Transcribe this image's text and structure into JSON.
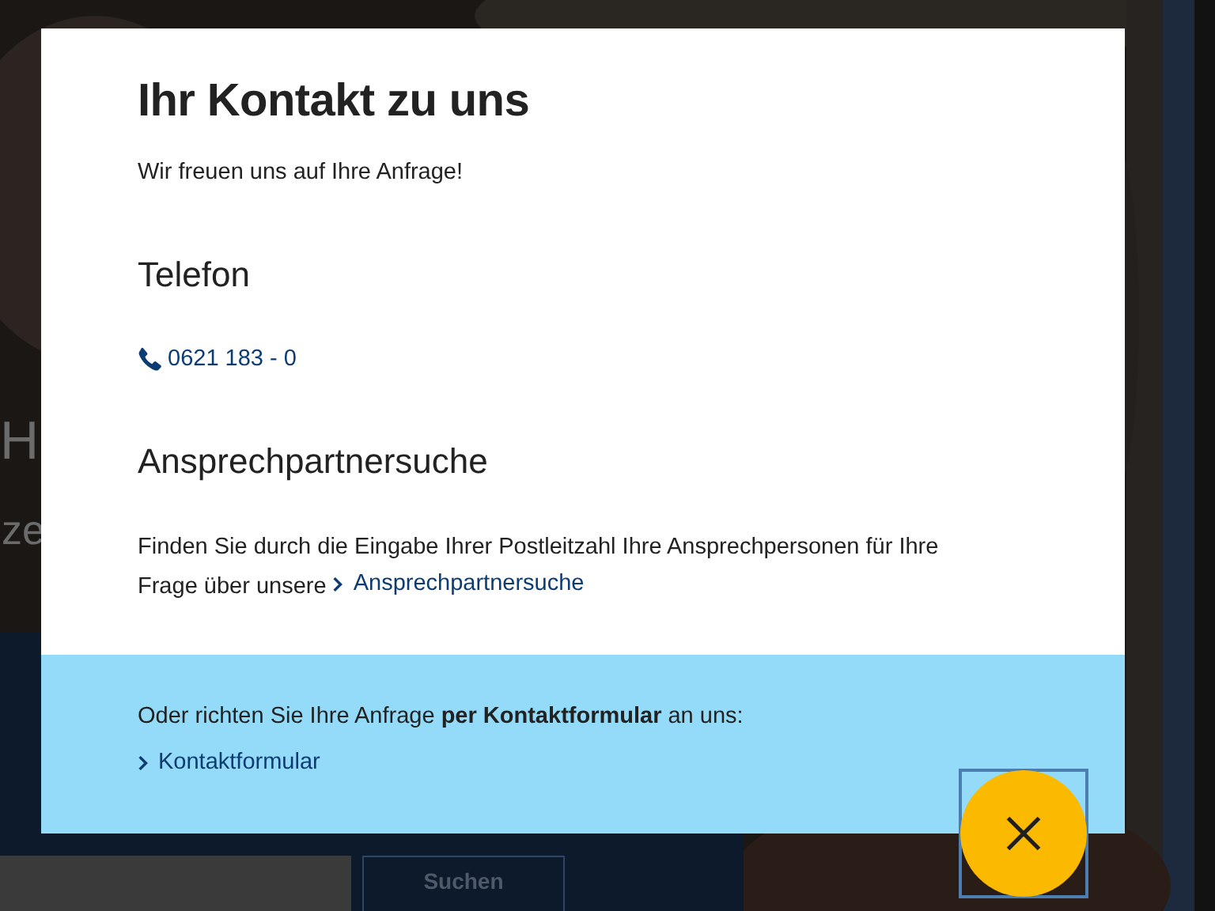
{
  "background": {
    "headline_fragment": "H",
    "subline_fragment": "ze",
    "search_button": "Suchen"
  },
  "dialog": {
    "title": "Ihr Kontakt zu uns",
    "intro": "Wir freuen uns auf Ihre Anfrage!",
    "phone": {
      "heading": "Telefon",
      "number": "0621 183 - 0"
    },
    "contact_search": {
      "heading": "Ansprechpartnersuche",
      "text": "Finden Sie durch die Eingabe Ihrer Postleitzahl Ihre Ansprechpersonen für Ihre Frage über unsere",
      "link": "Ansprechpartnersuche"
    },
    "form_box": {
      "text": "Oder richten Sie Ihre Anfrage **per Kontaktformular** an uns:",
      "link": "Kontaktformular"
    }
  }
}
